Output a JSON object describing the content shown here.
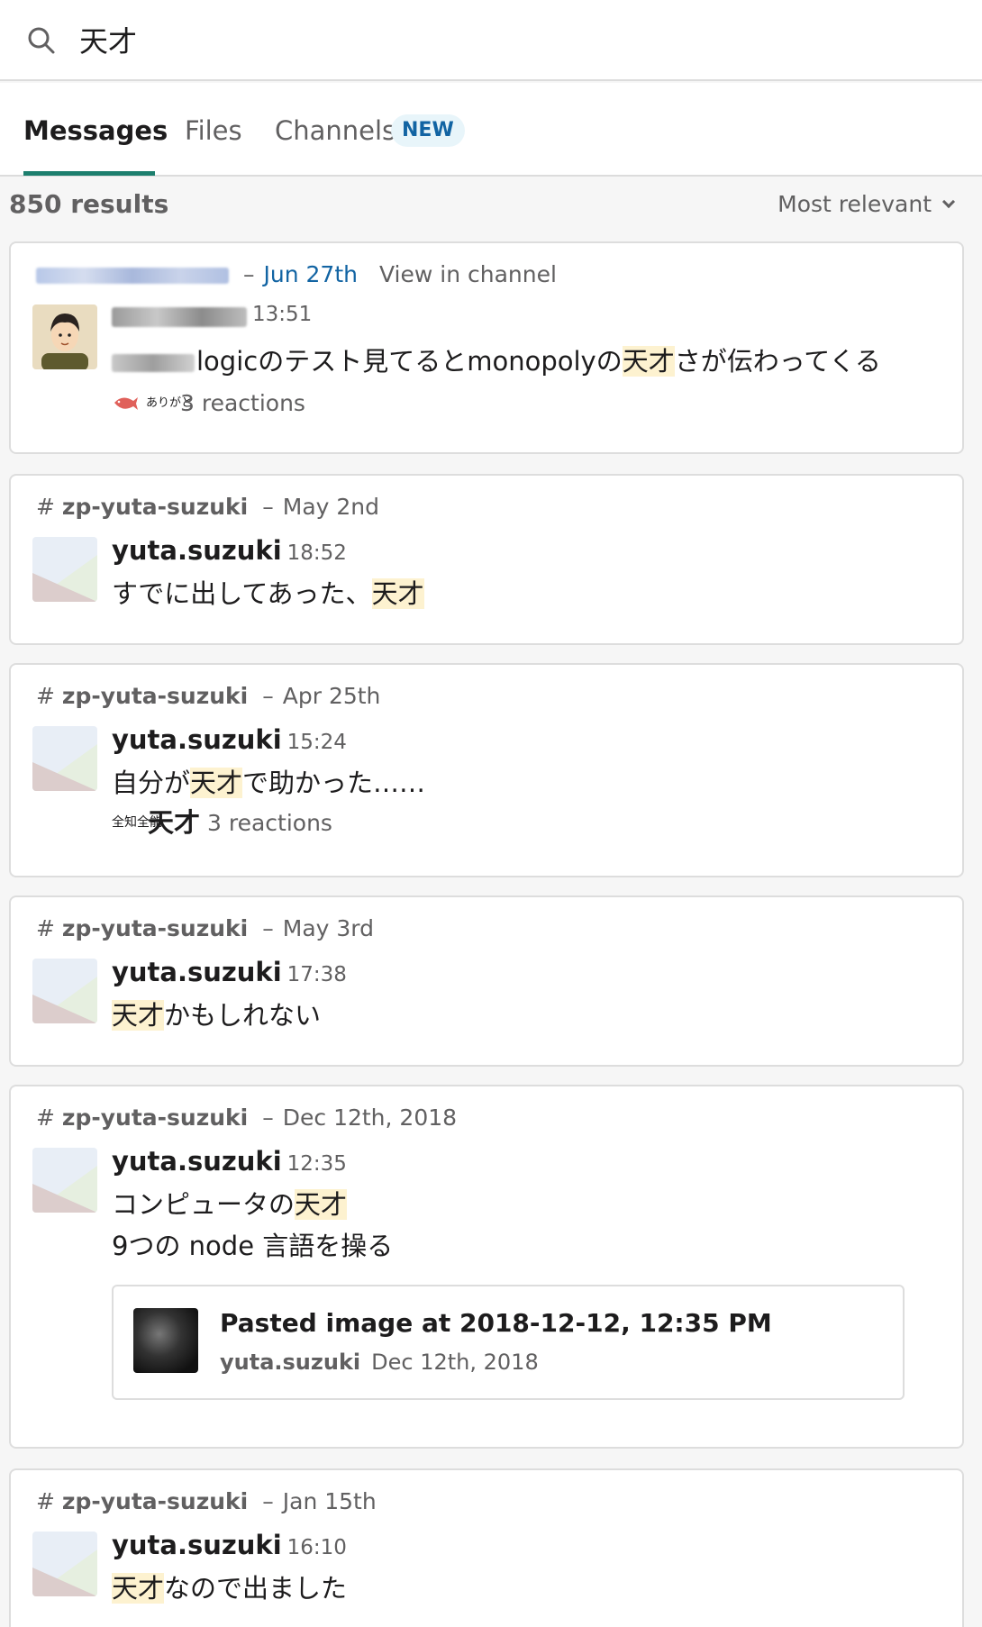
{
  "search": {
    "query": "天才"
  },
  "tabs": [
    {
      "label": "Messages",
      "active": true
    },
    {
      "label": "Files",
      "active": false
    },
    {
      "label": "Channels",
      "active": false,
      "badge": "NEW"
    }
  ],
  "results": {
    "count_label": "850 results",
    "sort_label": "Most relevant"
  },
  "colors": {
    "link": "#1264a3",
    "tab_indicator": "#1d7f6e",
    "highlight": "#fdf2d0"
  },
  "cards": [
    {
      "channel": "",
      "date": "Jun 27th",
      "view_in_channel": "View in channel",
      "author": "",
      "time": "13:51",
      "message_parts": [
        "logicのテスト見てるとmonopolyの",
        "天才",
        "さが伝わってくる"
      ],
      "reactions": {
        "emoji": [
          "fish-icon",
          "arigato-emoji"
        ],
        "emoji_text": "ありがと",
        "label": "3 reactions"
      }
    },
    {
      "channel": "zp-yuta-suzuki",
      "date": "May 2nd",
      "author": "yuta.suzuki",
      "time": "18:52",
      "message_parts": [
        "すでに出してあった、",
        "天才",
        ""
      ]
    },
    {
      "channel": "zp-yuta-suzuki",
      "date": "Apr 25th",
      "author": "yuta.suzuki",
      "time": "15:24",
      "message_parts": [
        "自分が",
        "天才",
        "で助かった……"
      ],
      "reactions": {
        "emoji": [
          "zenchi-zennou-emoji",
          "tensai-emoji"
        ],
        "emoji_text": "全知全能",
        "emoji_text_2": "天才",
        "label": "3 reactions"
      }
    },
    {
      "channel": "zp-yuta-suzuki",
      "date": "May 3rd",
      "author": "yuta.suzuki",
      "time": "17:38",
      "message_parts": [
        "",
        "天才",
        "かもしれない"
      ]
    },
    {
      "channel": "zp-yuta-suzuki",
      "date": "Dec 12th, 2018",
      "author": "yuta.suzuki",
      "time": "12:35",
      "message_parts": [
        "コンピュータの",
        "天才",
        ""
      ],
      "message_line2": "9つの node 言語を操る",
      "attachment": {
        "title": "Pasted image at 2018-12-12, 12:35 PM",
        "user": "yuta.suzuki",
        "date": "Dec 12th, 2018"
      }
    },
    {
      "channel": "zp-yuta-suzuki",
      "date": "Jan 15th",
      "author": "yuta.suzuki",
      "time": "16:10",
      "message_parts": [
        "",
        "天才",
        "なので出ました"
      ]
    }
  ]
}
